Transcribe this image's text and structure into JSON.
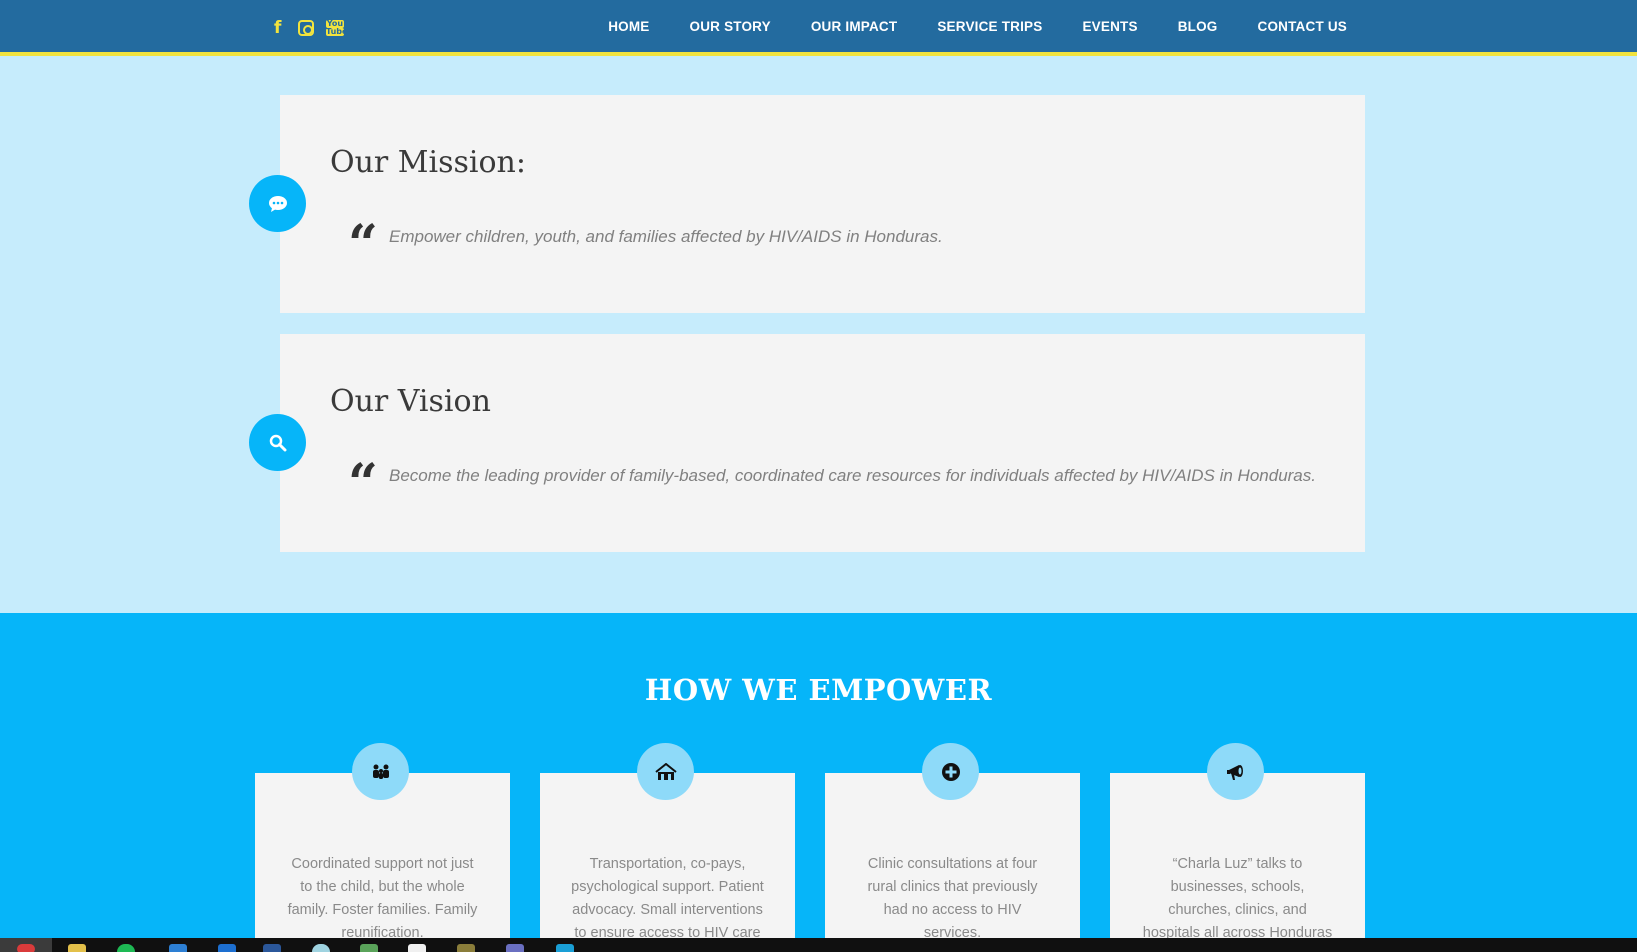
{
  "header": {
    "social": [
      "facebook-icon",
      "instagram-icon",
      "youtube-icon"
    ],
    "youtube_text": "You\nTube",
    "nav": [
      "HOME",
      "OUR STORY",
      "OUR IMPACT",
      "SERVICE TRIPS",
      "EVENTS",
      "BLOG",
      "CONTACT US"
    ]
  },
  "mission": {
    "title": "Our Mission:",
    "quote": "Empower children, youth, and families affected by HIV/AIDS in Honduras.",
    "icon": "speech-bubble-icon"
  },
  "vision": {
    "title": "Our Vision",
    "quote": "Become the leading provider of family-based, coordinated care resources for individuals affected by HIV/AIDS in Honduras.",
    "icon": "search-icon"
  },
  "empower": {
    "title": "HOW WE EMPOWER",
    "cards": [
      {
        "icon": "family-icon",
        "text": "Coordinated support not just to the child, but the whole family. Foster families. Family reunification."
      },
      {
        "icon": "houses-icon",
        "text": "Transportation, co-pays, psychological support. Patient advocacy. Small interventions to ensure access to HIV care and"
      },
      {
        "icon": "medical-plus-icon",
        "text": "Clinic consultations at four rural clinics that previously had no access to HIV services."
      },
      {
        "icon": "megaphone-icon",
        "text": "“Charla Luz” talks to businesses, schools, churches, clinics, and hospitals all across Honduras to reduce the stigma of the disease"
      }
    ]
  },
  "colors": {
    "header_bg": "#236b9f",
    "accent_yellow": "#f1e33e",
    "light_blue_bg": "#c6ecfc",
    "bright_blue": "#06b5f9",
    "badge_blue": "#8edaf9",
    "card_bg": "#f4f4f4"
  }
}
